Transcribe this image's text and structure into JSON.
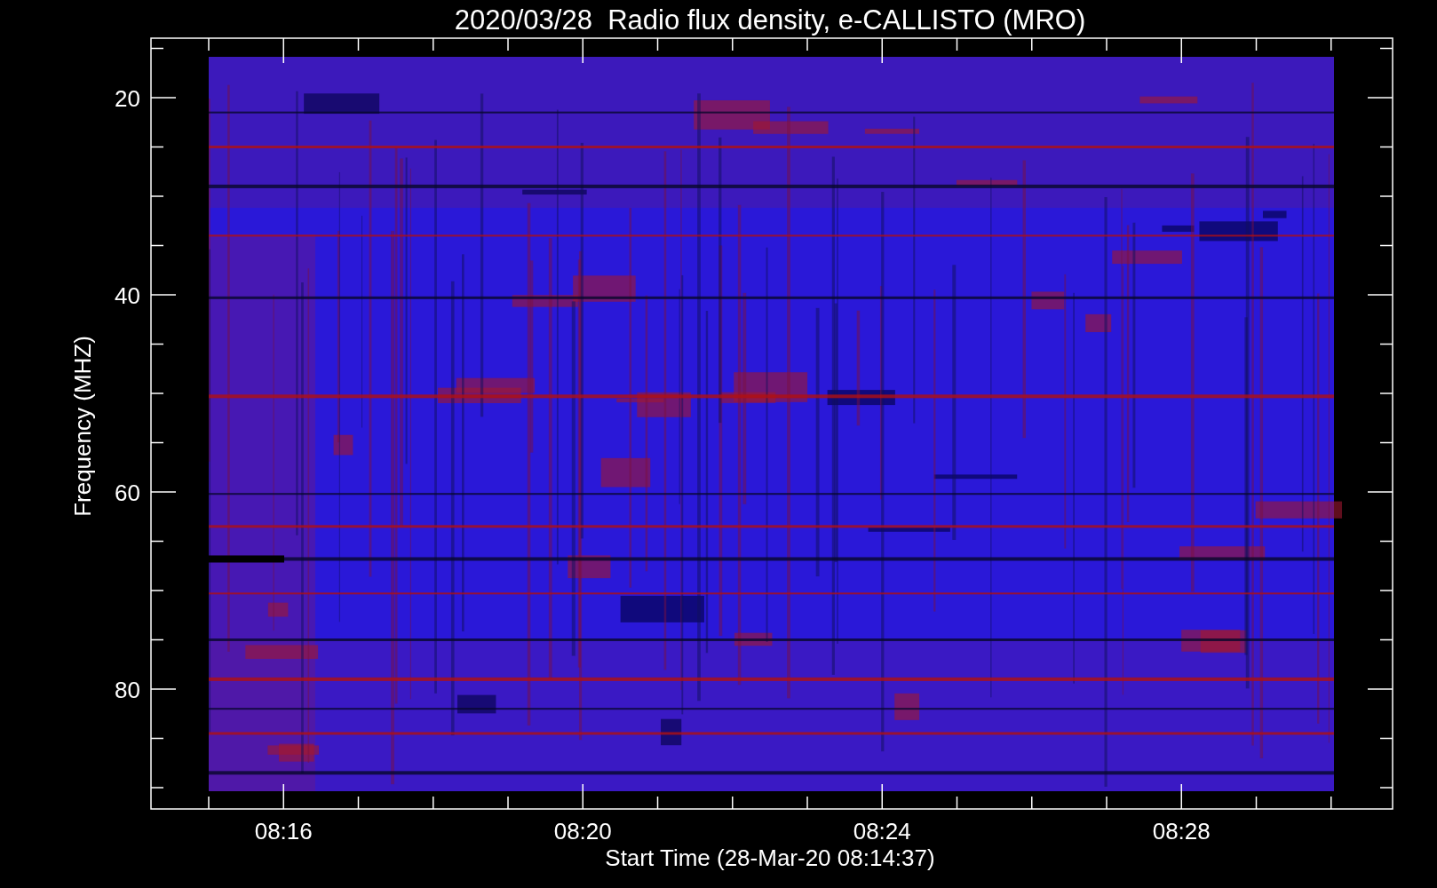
{
  "title": "2020/03/28  Radio flux density, e-CALLISTO (MRO)",
  "plot": {
    "ylabel": "Frequency (MHZ)",
    "xlabel": "Start Time (28-Mar-20 08:14:37)",
    "yticks": [
      "20",
      "40",
      "60",
      "80"
    ],
    "xticks": [
      "08:16",
      "08:20",
      "08:24",
      "08:28"
    ]
  }
}
